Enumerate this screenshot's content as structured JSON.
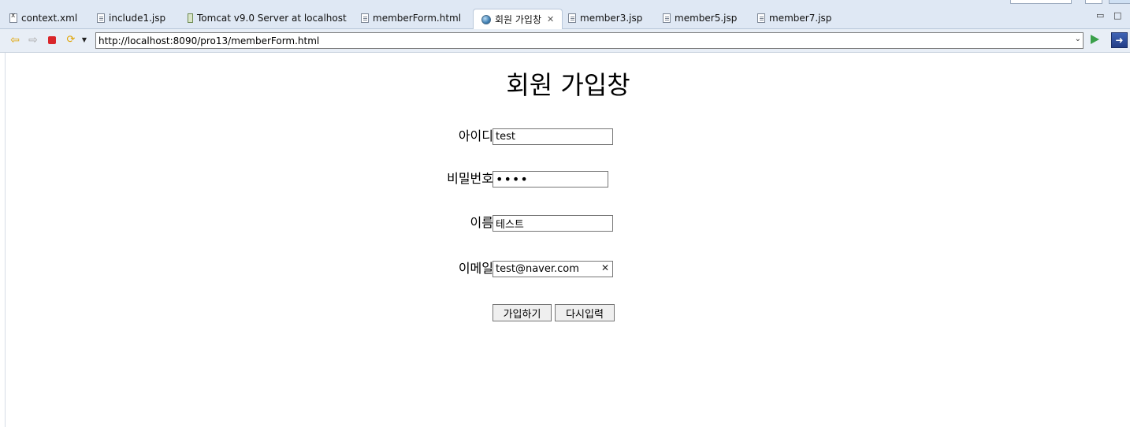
{
  "tabs": [
    {
      "label": "context.xml",
      "icon": "xml-file-icon"
    },
    {
      "label": "include1.jsp",
      "icon": "jsp-file-icon"
    },
    {
      "label": "Tomcat v9.0 Server at localhost",
      "icon": "server-icon"
    },
    {
      "label": "memberForm.html",
      "icon": "html-file-icon"
    },
    {
      "label": "회원 가입창",
      "icon": "globe-icon",
      "active": true
    },
    {
      "label": "member3.jsp",
      "icon": "jsp-file-icon"
    },
    {
      "label": "member5.jsp",
      "icon": "jsp-file-icon"
    },
    {
      "label": "member7.jsp",
      "icon": "jsp-file-icon"
    }
  ],
  "toolbar": {
    "url": "http://localhost:8090/pro13/memberForm.html"
  },
  "page": {
    "title": "회원 가입창",
    "fields": {
      "id": {
        "label": "아이디",
        "value": "test"
      },
      "password": {
        "label": "비밀번호",
        "value": "••••"
      },
      "name": {
        "label": "이름",
        "value": "테스트"
      },
      "email": {
        "label": "이메일",
        "value": "test@naver.com"
      }
    },
    "buttons": {
      "submit": "가입하기",
      "reset": "다시입력"
    }
  },
  "colors": {
    "tabbar_bg": "#dfe8f4",
    "toolbar_bg": "#e8eef6",
    "go_green": "#3aa04a",
    "stop_red": "#d9262a"
  }
}
